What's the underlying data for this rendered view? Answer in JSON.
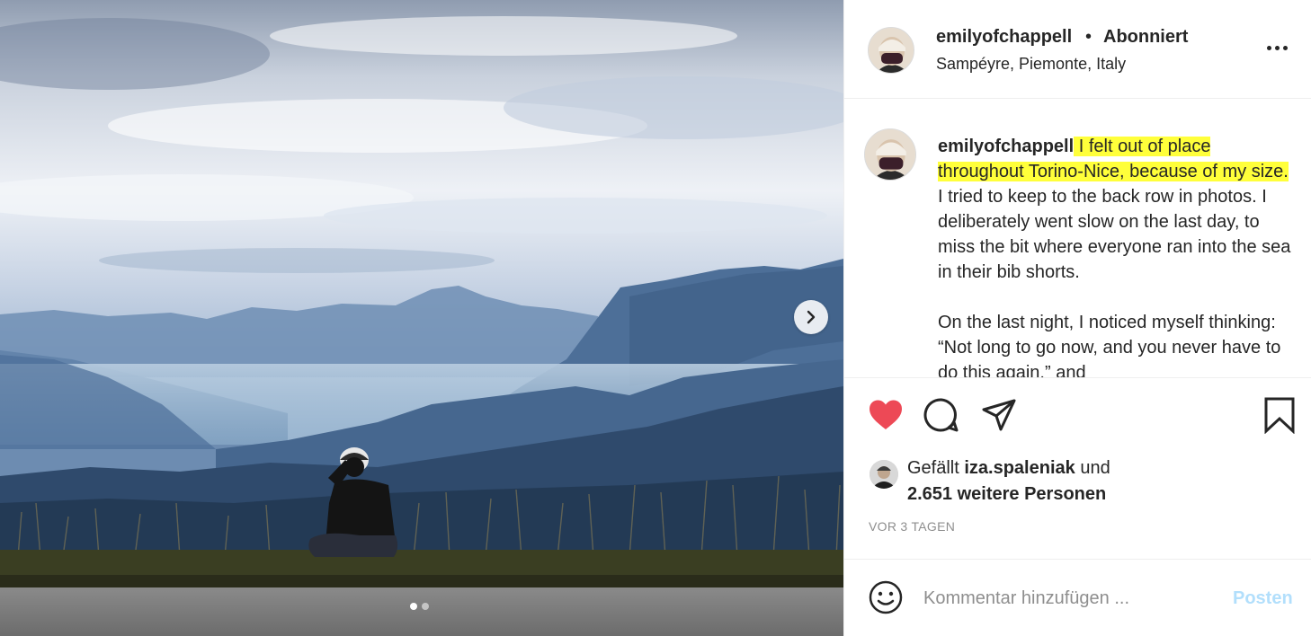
{
  "post": {
    "images_count": 2,
    "active_image": 1
  },
  "header": {
    "username": "emilyofchappell",
    "separator": "•",
    "follow_status": "Abonniert",
    "location": "Sampéyre, Piemonte, Italy",
    "more_icon": "more-horizontal-icon"
  },
  "caption": {
    "username": "emilyofchappell",
    "highlighted": " I felt out of place throughout Torino-Nice, because of my size.",
    "text1": " I tried to keep to the back row in photos. I deliberately went slow on the last day, to miss the bit where everyone ran into the sea in their bib shorts.",
    "text2": "On the last night, I noticed myself thinking: “Not long to go now, and you never have to do this again,” and",
    "highlight_color": "#ffff3a"
  },
  "actions": {
    "like_icon": "heart-filled-icon",
    "like_color": "#ed4956",
    "comment_icon": "comment-bubble-icon",
    "share_icon": "paper-plane-icon",
    "save_icon": "bookmark-icon"
  },
  "likes": {
    "prefix": "Gefällt ",
    "user": "iza.spaleniak",
    "connector": " und",
    "others": "2.651 weitere Personen"
  },
  "timestamp": "VOR 3 TAGEN",
  "comment": {
    "placeholder": "Kommentar hinzufügen ...",
    "post_label": "Posten",
    "post_color": "#b2dffc"
  }
}
